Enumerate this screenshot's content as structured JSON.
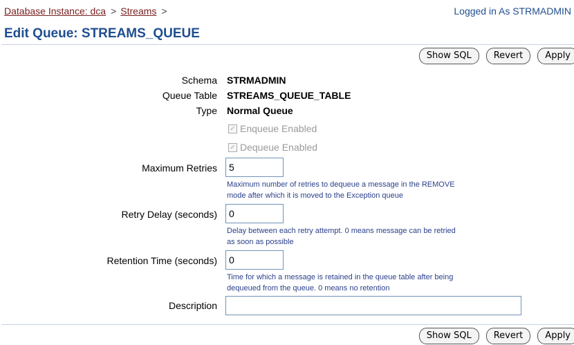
{
  "breadcrumb": {
    "item1": "Database Instance: dca",
    "item2": "Streams",
    "sep": ">"
  },
  "login_text": "Logged in As STRMADMIN",
  "page_title": "Edit Queue: STREAMS_QUEUE",
  "buttons": {
    "show_sql": "Show SQL",
    "revert": "Revert",
    "apply": "Apply"
  },
  "info": {
    "schema_label": "Schema",
    "schema_value": "STRMADMIN",
    "queue_table_label": "Queue Table",
    "queue_table_value": "STREAMS_QUEUE_TABLE",
    "type_label": "Type",
    "type_value": "Normal Queue"
  },
  "checkboxes": {
    "enqueue_label": "Enqueue Enabled",
    "enqueue_checked": true,
    "dequeue_label": "Dequeue Enabled",
    "dequeue_checked": true
  },
  "fields": {
    "max_retries": {
      "label": "Maximum Retries",
      "value": "5",
      "hint1": "Maximum number of retries to dequeue a message in the REMOVE",
      "hint2": "mode after which it is moved to the Exception queue"
    },
    "retry_delay": {
      "label": "Retry Delay (seconds)",
      "value": "0",
      "hint1": "Delay between each retry attempt. 0 means message can be retried",
      "hint2": "as soon as possible"
    },
    "retention_time": {
      "label": "Retention Time (seconds)",
      "value": "0",
      "hint1": "Time for which a message is retained in the queue table after being",
      "hint2": "dequeued from the queue. 0 means no retention"
    },
    "description": {
      "label": "Description",
      "value": ""
    }
  }
}
